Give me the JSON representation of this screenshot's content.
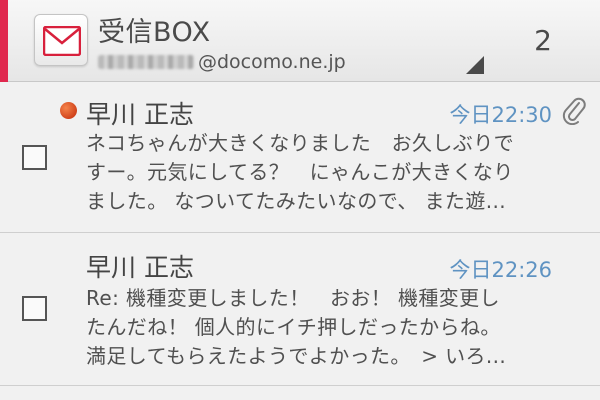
{
  "header": {
    "folder_title": "受信BOX",
    "account_suffix": "@docomo.ne.jp",
    "unread_count": "2",
    "accent_color": "#e0284e"
  },
  "mails": [
    {
      "sender": "早川 正志",
      "time": "今日22:30",
      "unread": true,
      "has_attachment": true,
      "preview_lines": [
        "ネコちゃんが大きくなりました　お久しぶりで",
        "すー。元気にしてる？　にゃんこが大きくなり",
        "ました。 なついてたみたいなので、 また遊..."
      ]
    },
    {
      "sender": "早川 正志",
      "time": "今日22:26",
      "unread": false,
      "has_attachment": false,
      "preview_lines": [
        "Re: 機種変更しました！　おお！ 機種変更し",
        "たんだね！ 個人的にイチ押しだったからね。",
        "満足してもらえたようでよかった。　> いろ..."
      ]
    }
  ],
  "icons": {
    "app": "mail-envelope-icon",
    "dropdown": "dropdown-corner-icon",
    "attachment": "paperclip-icon",
    "unread": "unread-dot-icon"
  }
}
